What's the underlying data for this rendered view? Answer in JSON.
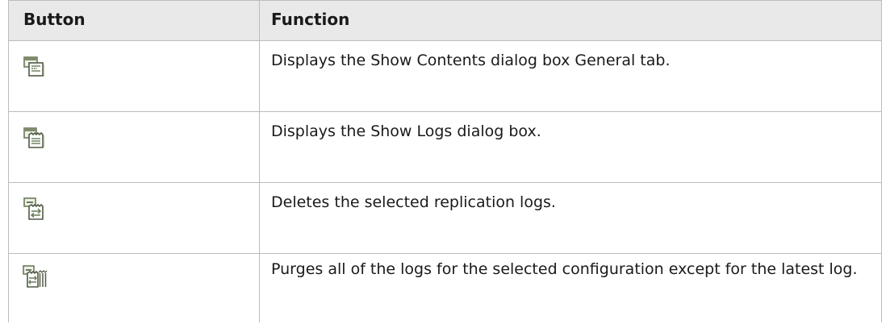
{
  "table": {
    "headers": {
      "button": "Button",
      "function": "Function"
    },
    "rows": [
      {
        "icon": "show-contents-icon",
        "function": "Displays the Show Contents dialog box General tab."
      },
      {
        "icon": "show-logs-icon",
        "function": "Displays the Show Logs dialog box."
      },
      {
        "icon": "delete-logs-icon",
        "function": "Deletes the selected replication logs."
      },
      {
        "icon": "purge-logs-icon",
        "function": "Purges all of the logs for the selected configuration except for the latest log."
      }
    ]
  },
  "colors": {
    "header_bg": "#e9e9e9",
    "border": "#bcbcbc",
    "icon_main": "#6a7a5a",
    "icon_light": "#eef2e6"
  }
}
